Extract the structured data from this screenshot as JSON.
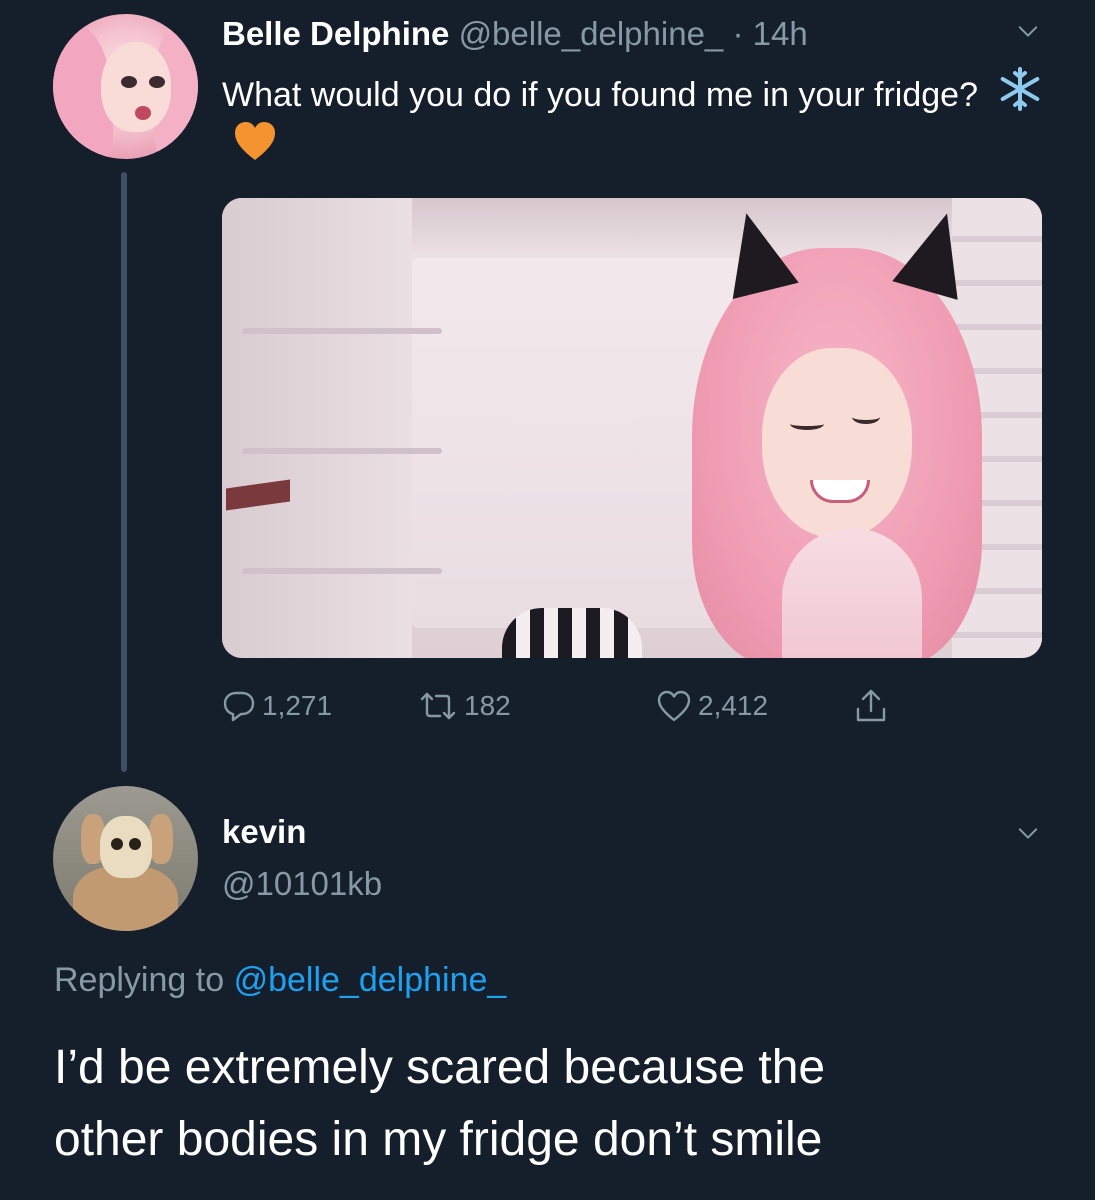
{
  "tweet": {
    "author": {
      "display_name": "Belle Delphine",
      "handle": "@belle_delphine_",
      "time": "14h",
      "separator": "·"
    },
    "text": "What would you do if you found me in your fridge?",
    "emojis": [
      "snowflake-icon",
      "orange-heart-icon"
    ],
    "stats": {
      "replies": "1,271",
      "retweets": "182",
      "likes": "2,412"
    }
  },
  "reply": {
    "author": {
      "display_name": "kevin",
      "handle": "@10101kb"
    },
    "replying_prefix": "Replying to",
    "replying_to": "@belle_delphine_",
    "text_line1": "I’d be extremely scared because the",
    "text_line2": "other bodies in my fridge don’t smile"
  },
  "colors": {
    "background": "#151f2b",
    "muted_text": "#8899a6",
    "link": "#1da1f2",
    "text": "#ffffff",
    "heart": "#f59330"
  }
}
